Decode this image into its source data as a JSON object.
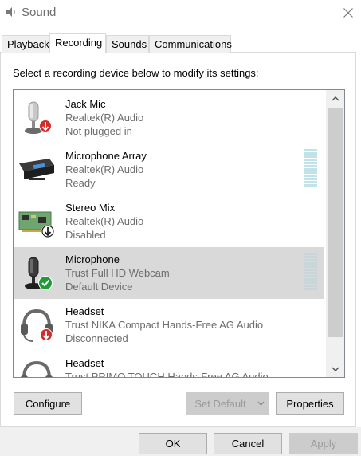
{
  "window": {
    "title": "Sound",
    "icon": "speaker-icon"
  },
  "tabs": [
    {
      "label": "Playback"
    },
    {
      "label": "Recording"
    },
    {
      "label": "Sounds"
    },
    {
      "label": "Communications"
    }
  ],
  "instructions": "Select a recording device below to modify its settings:",
  "devices": [
    {
      "name": "Jack Mic",
      "driver": "Realtek(R) Audio",
      "status": "Not plugged in",
      "icon": "desk-microphone-icon",
      "badge": "red-down-arrow",
      "level_meter": false
    },
    {
      "name": "Microphone Array",
      "driver": "Realtek(R) Audio",
      "status": "Ready",
      "icon": "microphone-array-icon",
      "badge": "none",
      "level_meter": true
    },
    {
      "name": "Stereo Mix",
      "driver": "Realtek(R) Audio",
      "status": "Disabled",
      "icon": "sound-card-icon",
      "badge": "black-down-arrow",
      "level_meter": false
    },
    {
      "name": "Microphone",
      "driver": "Trust Full HD Webcam",
      "status": "Default Device",
      "icon": "desk-microphone-icon",
      "badge": "green-check",
      "level_meter": true,
      "selected": true
    },
    {
      "name": "Headset",
      "driver": "Trust NIKA Compact Hands-Free AG Audio",
      "status": "Disconnected",
      "icon": "headset-icon",
      "badge": "red-down-arrow",
      "level_meter": false
    },
    {
      "name": "Headset",
      "driver": "Trust PRIMO TOUCH Hands-Free AG Audio",
      "status": "",
      "icon": "headset-icon",
      "badge": "none",
      "level_meter": false
    }
  ],
  "buttons": {
    "configure": "Configure",
    "set_default": "Set Default",
    "properties": "Properties",
    "ok": "OK",
    "cancel": "Cancel",
    "apply": "Apply"
  },
  "colors": {
    "selection": "#d9d9d9",
    "meter": "#bfe3e8",
    "status_text": "#6d6d6d"
  }
}
